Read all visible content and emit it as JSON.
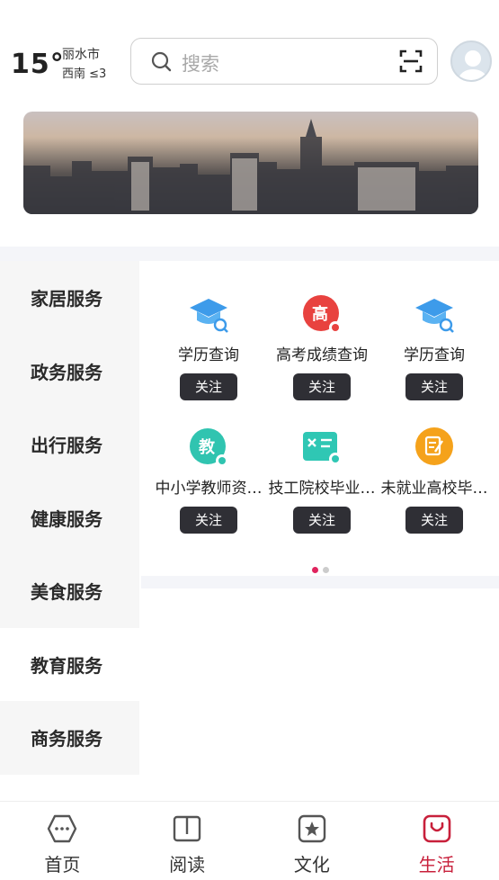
{
  "weather": {
    "temp": "15°",
    "city": "丽水市",
    "wind": "西南 ≤3"
  },
  "search": {
    "placeholder": "搜索"
  },
  "categories": [
    {
      "label": "家居服务"
    },
    {
      "label": "政务服务"
    },
    {
      "label": "出行服务"
    },
    {
      "label": "健康服务"
    },
    {
      "label": "美食服务"
    },
    {
      "label": "教育服务"
    },
    {
      "label": "商务服务"
    }
  ],
  "services": [
    {
      "label": "学历查询",
      "follow": "关注",
      "icon": "graduation-cap-search-icon"
    },
    {
      "label": "高考成绩查询",
      "follow": "关注",
      "icon": "gaokao-score-icon",
      "glyph": "高"
    },
    {
      "label": "学历查询",
      "follow": "关注",
      "icon": "graduation-cap-search-icon"
    },
    {
      "label": "中小学教师资…",
      "follow": "关注",
      "icon": "teacher-cert-icon",
      "glyph": "教"
    },
    {
      "label": "技工院校毕业…",
      "follow": "关注",
      "icon": "technical-school-icon"
    },
    {
      "label": "未就业高校毕…",
      "follow": "关注",
      "icon": "graduate-register-icon"
    }
  ],
  "colors": {
    "accent": "#c8203b",
    "dot_active": "#e0245e",
    "dot_inactive": "#cccccc",
    "follow_bg": "#2f2f35"
  },
  "tabs": [
    {
      "label": "首页",
      "icon": "home-hex-icon"
    },
    {
      "label": "阅读",
      "icon": "book-icon"
    },
    {
      "label": "文化",
      "icon": "star-box-icon"
    },
    {
      "label": "生活",
      "icon": "bag-icon",
      "active": true
    }
  ]
}
